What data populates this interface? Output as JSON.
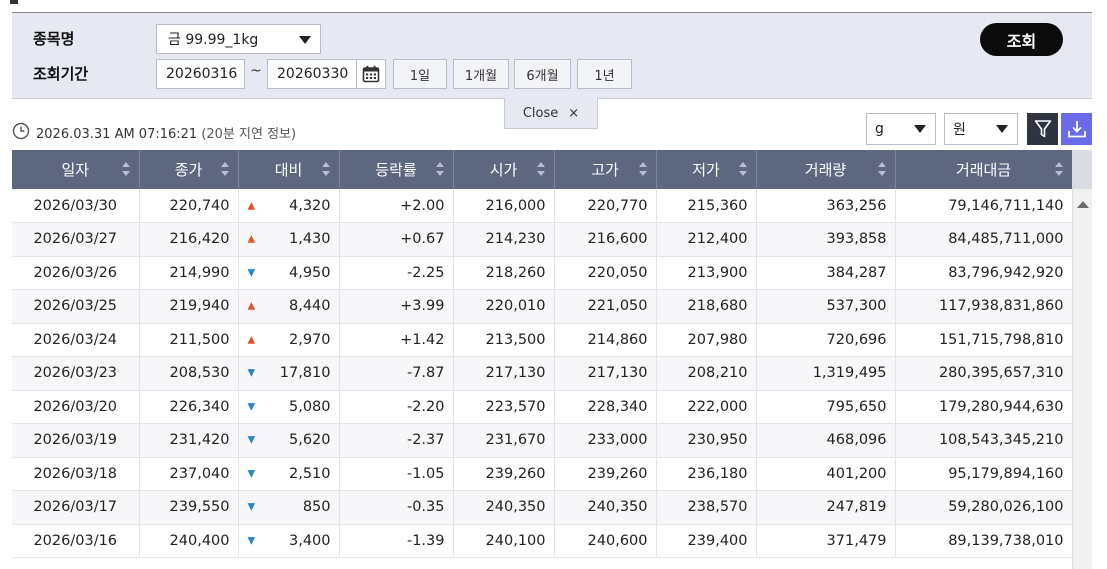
{
  "search": {
    "item_label": "종목명",
    "period_label": "조회기간",
    "item_value": "금 99.99_1kg",
    "start_date": "20260316",
    "end_date": "20260330",
    "range_separator": "~",
    "period_buttons": [
      "1일",
      "1개월",
      "6개월",
      "1년"
    ],
    "submit_label": "조회",
    "close_label": "Close",
    "close_glyph": "×"
  },
  "info": {
    "timestamp": "2026.03.31 AM 07:16:21",
    "delay_note": "(20분 지연 정보)",
    "weight_unit": "g",
    "currency_unit": "원"
  },
  "colors": {
    "header_bg": "#5e6780",
    "panel_bg": "#e6e8f2",
    "up": "#e1542a",
    "down": "#2a86c9",
    "download_btn": "#6a6be8",
    "filter_btn": "#2e3540"
  },
  "icons": {
    "calendar": "calendar-icon",
    "clock": "clock-icon",
    "filter": "filter-icon",
    "download": "download-icon",
    "sort": "sort-icon"
  },
  "table": {
    "columns": [
      "일자",
      "종가",
      "대비",
      "등락률",
      "시가",
      "고가",
      "저가",
      "거래량",
      "거래대금"
    ],
    "rows": [
      {
        "date": "2026/03/30",
        "close": "220,740",
        "dir": "up",
        "change": "4,320",
        "rate": "+2.00",
        "open": "216,000",
        "high": "220,770",
        "low": "215,360",
        "volume": "363,256",
        "amount": "79,146,711,140"
      },
      {
        "date": "2026/03/27",
        "close": "216,420",
        "dir": "up",
        "change": "1,430",
        "rate": "+0.67",
        "open": "214,230",
        "high": "216,600",
        "low": "212,400",
        "volume": "393,858",
        "amount": "84,485,711,000"
      },
      {
        "date": "2026/03/26",
        "close": "214,990",
        "dir": "down",
        "change": "4,950",
        "rate": "-2.25",
        "open": "218,260",
        "high": "220,050",
        "low": "213,900",
        "volume": "384,287",
        "amount": "83,796,942,920"
      },
      {
        "date": "2026/03/25",
        "close": "219,940",
        "dir": "up",
        "change": "8,440",
        "rate": "+3.99",
        "open": "220,010",
        "high": "221,050",
        "low": "218,680",
        "volume": "537,300",
        "amount": "117,938,831,860"
      },
      {
        "date": "2026/03/24",
        "close": "211,500",
        "dir": "up",
        "change": "2,970",
        "rate": "+1.42",
        "open": "213,500",
        "high": "214,860",
        "low": "207,980",
        "volume": "720,696",
        "amount": "151,715,798,810"
      },
      {
        "date": "2026/03/23",
        "close": "208,530",
        "dir": "down",
        "change": "17,810",
        "rate": "-7.87",
        "open": "217,130",
        "high": "217,130",
        "low": "208,210",
        "volume": "1,319,495",
        "amount": "280,395,657,310"
      },
      {
        "date": "2026/03/20",
        "close": "226,340",
        "dir": "down",
        "change": "5,080",
        "rate": "-2.20",
        "open": "223,570",
        "high": "228,340",
        "low": "222,000",
        "volume": "795,650",
        "amount": "179,280,944,630"
      },
      {
        "date": "2026/03/19",
        "close": "231,420",
        "dir": "down",
        "change": "5,620",
        "rate": "-2.37",
        "open": "231,670",
        "high": "233,000",
        "low": "230,950",
        "volume": "468,096",
        "amount": "108,543,345,210"
      },
      {
        "date": "2026/03/18",
        "close": "237,040",
        "dir": "down",
        "change": "2,510",
        "rate": "-1.05",
        "open": "239,260",
        "high": "239,260",
        "low": "236,180",
        "volume": "401,200",
        "amount": "95,179,894,160"
      },
      {
        "date": "2026/03/17",
        "close": "239,550",
        "dir": "down",
        "change": "850",
        "rate": "-0.35",
        "open": "240,350",
        "high": "240,350",
        "low": "238,570",
        "volume": "247,819",
        "amount": "59,280,026,100"
      },
      {
        "date": "2026/03/16",
        "close": "240,400",
        "dir": "down",
        "change": "3,400",
        "rate": "-1.39",
        "open": "240,100",
        "high": "240,600",
        "low": "239,400",
        "volume": "371,479",
        "amount": "89,139,738,010"
      }
    ]
  }
}
